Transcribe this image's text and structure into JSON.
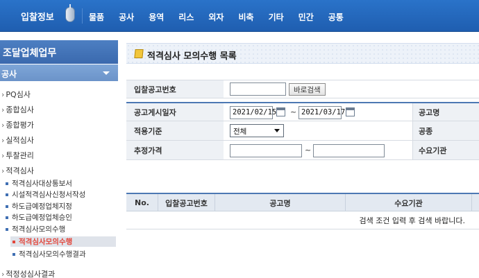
{
  "topnav": {
    "brand": "입찰정보",
    "items": [
      "물품",
      "공사",
      "용역",
      "리스",
      "외자",
      "비축",
      "기타",
      "민간",
      "공통"
    ]
  },
  "sidebar": {
    "title": "조달업체업무",
    "category": "공사",
    "items": [
      {
        "label": "PQ심사"
      },
      {
        "label": "종합심사"
      },
      {
        "label": "종합평가"
      },
      {
        "label": "실적심사"
      },
      {
        "label": "투찰관리"
      },
      {
        "label": "적격심사"
      }
    ],
    "subitems": [
      "적격심사대상통보서",
      "시설적격심사신청서작성",
      "하도급예정업체지정",
      "하도급예정업체승인",
      "적격심사모의수행"
    ],
    "subsubitems": [
      {
        "label": "적격심사모의수행",
        "active": true
      },
      {
        "label": "적격심사모의수행결과",
        "active": false
      }
    ],
    "last_item": "적정성심사결과"
  },
  "main": {
    "title": "적격심사 모의수행 목록",
    "form": {
      "bid_no_label": "입찰공고번호",
      "bid_no_value": "",
      "search_button": "바로검색",
      "date_label": "공고게시일자",
      "date_from": "2021/02/15",
      "date_to": "2021/03/17",
      "date_sep": "~",
      "notice_name_label": "공고명",
      "standard_label": "적용기준",
      "standard_value": "전체",
      "work_type_label": "공종",
      "price_label": "추정가격",
      "price_from": "",
      "price_to": "",
      "price_sep": "~",
      "demand_org_label": "수요기관"
    },
    "table": {
      "columns": [
        "No.",
        "입찰공고번호",
        "공고명",
        "수요기관"
      ],
      "empty_message": "검색 조건 입력 후 검색 바랍니다."
    }
  }
}
